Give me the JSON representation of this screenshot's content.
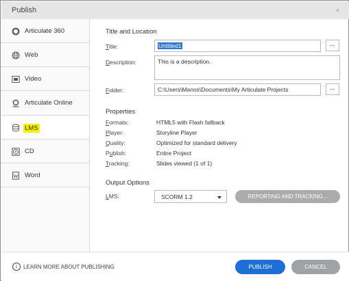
{
  "window": {
    "title": "Publish",
    "close_glyph": "×"
  },
  "sidebar": {
    "items": [
      {
        "label": "Articulate 360",
        "icon": "articulate-360-icon"
      },
      {
        "label": "Web",
        "icon": "globe-icon"
      },
      {
        "label": "Video",
        "icon": "video-icon"
      },
      {
        "label": "Articulate Online",
        "icon": "articulate-online-icon"
      },
      {
        "label": "LMS",
        "icon": "database-icon"
      },
      {
        "label": "CD",
        "icon": "cd-icon"
      },
      {
        "label": "Word",
        "icon": "word-document-icon"
      }
    ],
    "selected": "LMS",
    "highlight_color": "#f3f300"
  },
  "title_location": {
    "heading": "Title and Location",
    "title_label": "Title:",
    "title_value": "Untitled1",
    "description_label": "Description:",
    "description_value": "This is a description.",
    "folder_label": "Folder:",
    "folder_value": "C:\\Users\\Manos\\Documents\\My Articulate Projects",
    "browse_label": "..."
  },
  "properties": {
    "heading": "Properties",
    "rows": [
      {
        "label": "Formats:",
        "value": "HTML5 with Flash fallback"
      },
      {
        "label": "Player:",
        "value": "Storyline Player"
      },
      {
        "label": "Quality:",
        "value": "Optimized for standard delivery"
      },
      {
        "label": "Publish:",
        "value": "Entire Project"
      },
      {
        "label": "Tracking:",
        "value": "Slides viewed (1 of 1)"
      }
    ]
  },
  "output": {
    "heading": "Output Options",
    "lms_label": "LMS:",
    "lms_value": "SCORM 1.2",
    "reporting_button": "REPORTING AND TRACKING..."
  },
  "footer": {
    "info_glyph": "i",
    "learn_more": "LEARN MORE ABOUT PUBLISHING",
    "publish": "PUBLISH",
    "cancel": "CANCEL"
  },
  "colors": {
    "publish_button": "#1d6fd6",
    "cancel_button": "#9fa2a5",
    "reporting_button": "#a9abad",
    "title_selection": "#2f76d2"
  }
}
